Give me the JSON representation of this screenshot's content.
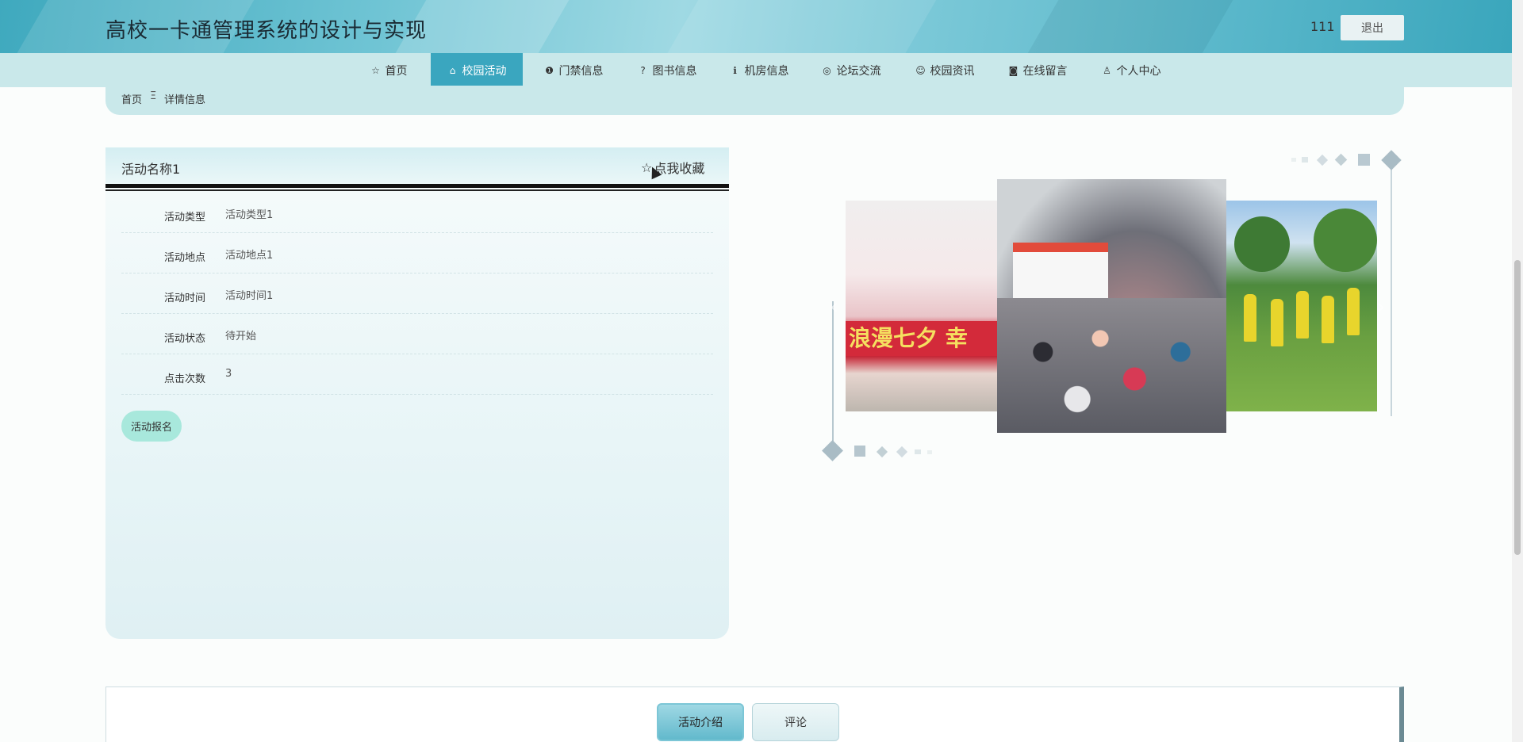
{
  "header": {
    "title": "高校一卡通管理系统的设计与实现",
    "user": "111",
    "logout_label": "退出"
  },
  "nav": {
    "items": [
      {
        "label": "首页",
        "icon": "star-icon"
      },
      {
        "label": "校园活动",
        "icon": "bag-icon",
        "active": true
      },
      {
        "label": "门禁信息",
        "icon": "info-icon"
      },
      {
        "label": "图书信息",
        "icon": "question-icon"
      },
      {
        "label": "机房信息",
        "icon": "info-icon"
      },
      {
        "label": "论坛交流",
        "icon": "chat-icon"
      },
      {
        "label": "校园资讯",
        "icon": "smile-icon"
      },
      {
        "label": "在线留言",
        "icon": "camera-icon"
      },
      {
        "label": "个人中心",
        "icon": "user-icon"
      }
    ]
  },
  "breadcrumb": {
    "home": "首页",
    "separator": "Ξ",
    "current": "详情信息"
  },
  "detail": {
    "title": "活动名称1",
    "favorite_label": "点我收藏",
    "favorite_icon": "☆",
    "rows": [
      {
        "label": "活动类型",
        "value": "活动类型1"
      },
      {
        "label": "活动地点",
        "value": "活动地点1"
      },
      {
        "label": "活动时间",
        "value": "活动时间1"
      },
      {
        "label": "活动状态",
        "value": "待开始"
      },
      {
        "label": "点击次数",
        "value": "3"
      }
    ],
    "signup_label": "活动报名"
  },
  "carousel": {
    "slide1_banner": "浪漫七夕 幸"
  },
  "tabs": {
    "intro_label": "活动介绍",
    "comment_label": "评论"
  },
  "colors": {
    "accent": "#3aa6bf",
    "nav_bg": "#c9e8ea",
    "signup": "#a8e8dc"
  }
}
